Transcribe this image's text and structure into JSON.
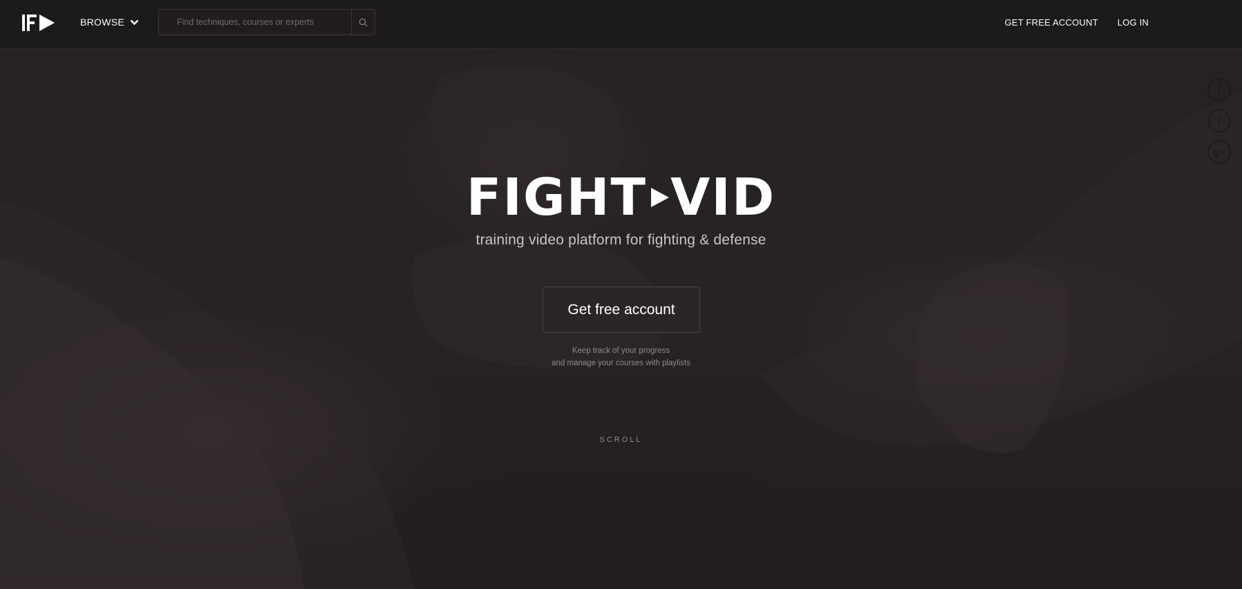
{
  "header": {
    "browse_label": "BROWSE",
    "search_placeholder": "Find techniques, courses or experts",
    "get_account_label": "GET FREE ACCOUNT",
    "login_label": "LOG IN"
  },
  "hero": {
    "brand_left": "FIGHT",
    "brand_right": "VID",
    "tagline": "training video platform for fighting & defense",
    "cta_label": "Get free account",
    "note_line1": "Keep track of your progress",
    "note_line2": "and manage your courses with playlists",
    "scroll_label": "SCROLL"
  },
  "social": {
    "facebook": "f",
    "twitter": "t",
    "google": "g+"
  },
  "colors": {
    "topbar": "#1d1a1b",
    "hero_bg": "#2a2527",
    "accent": "#ffffff"
  }
}
